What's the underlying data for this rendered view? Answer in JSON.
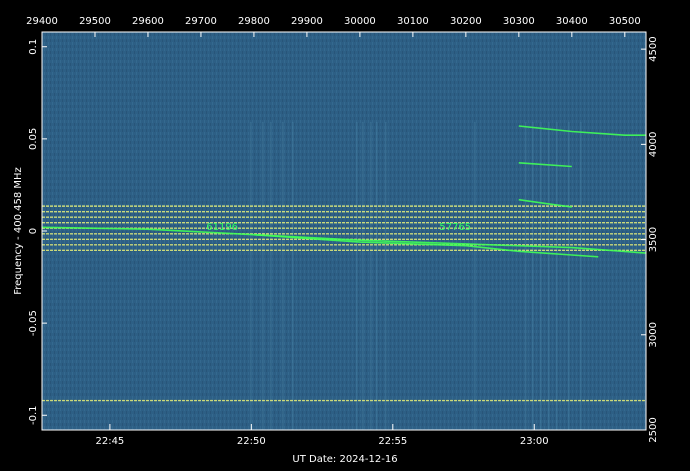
{
  "chart_data": {
    "type": "heatmap",
    "title": "",
    "xlabel": "UT Date: 2024-12-16",
    "ylabel": "Frequency - 400.458 MHz",
    "x_bottom_ticks": [
      "22:45",
      "22:50",
      "22:55",
      "23:00"
    ],
    "x_bottom_values": [
      2.0,
      7.0,
      12.0,
      17.0
    ],
    "x_top_ticks": [
      "29400",
      "29500",
      "29600",
      "29700",
      "29800",
      "29900",
      "30000",
      "30100",
      "30200",
      "30300",
      "30400",
      "30500"
    ],
    "x_top_values": [
      29400,
      29500,
      29600,
      29700,
      29800,
      29900,
      30000,
      30100,
      30200,
      30300,
      30400,
      30500
    ],
    "y_left_ticks": [
      "0.1",
      "0.05",
      "0",
      "-0.05",
      "-0.1"
    ],
    "y_left_values": [
      0.1,
      0.05,
      0,
      -0.05,
      -0.1
    ],
    "y_right_ticks": [
      "4500",
      "4000",
      "3500",
      "3000",
      "2500"
    ],
    "y_right_values": [
      4500,
      4000,
      3500,
      3000,
      2500
    ],
    "xlim": [
      29400,
      30540
    ],
    "ylim": [
      -0.108,
      0.108
    ],
    "y_right_lim": [
      2500,
      4590
    ],
    "background_color": "#2d5f85",
    "band_color": "#e6ef7a",
    "trace_color": "#40ff55",
    "annotations": [
      {
        "text": "61196",
        "x": 29710,
        "y": 0.0005
      },
      {
        "text": "57765",
        "x": 30150,
        "y": 0.0005
      }
    ],
    "horizontal_bands": [
      {
        "y": 0.0135,
        "x0": 29400,
        "x1": 30540
      },
      {
        "y": 0.0105,
        "x0": 29400,
        "x1": 30540
      },
      {
        "y": 0.0075,
        "x0": 29400,
        "x1": 30540
      },
      {
        "y": 0.0045,
        "x0": 29400,
        "x1": 30540
      },
      {
        "y": 0.0015,
        "x0": 29400,
        "x1": 30540
      },
      {
        "y": -0.0015,
        "x0": 29400,
        "x1": 30540
      },
      {
        "y": -0.0045,
        "x0": 29400,
        "x1": 30540
      },
      {
        "y": -0.0075,
        "x0": 29400,
        "x1": 30540
      },
      {
        "y": -0.0105,
        "x0": 29400,
        "x1": 30540
      },
      {
        "y": -0.092,
        "x0": 29400,
        "x1": 30540
      }
    ],
    "traces": [
      {
        "x": [
          29400,
          29600,
          29800,
          30000,
          30200,
          30400,
          30540
        ],
        "y": [
          0.002,
          0.001,
          -0.002,
          -0.005,
          -0.007,
          -0.009,
          -0.012
        ]
      },
      {
        "x": [
          29800,
          29900,
          30000,
          30100,
          30200,
          30300,
          30400,
          30450
        ],
        "y": [
          -0.002,
          -0.004,
          -0.006,
          -0.007,
          -0.008,
          -0.011,
          -0.013,
          -0.014
        ]
      },
      {
        "x": [
          30300,
          30400,
          30500,
          30540
        ],
        "y": [
          0.057,
          0.054,
          0.052,
          0.052
        ]
      },
      {
        "x": [
          30300,
          30400
        ],
        "y": [
          0.037,
          0.035
        ]
      },
      {
        "x": [
          30300,
          30350,
          30400
        ],
        "y": [
          0.017,
          0.015,
          0.013
        ]
      }
    ]
  }
}
